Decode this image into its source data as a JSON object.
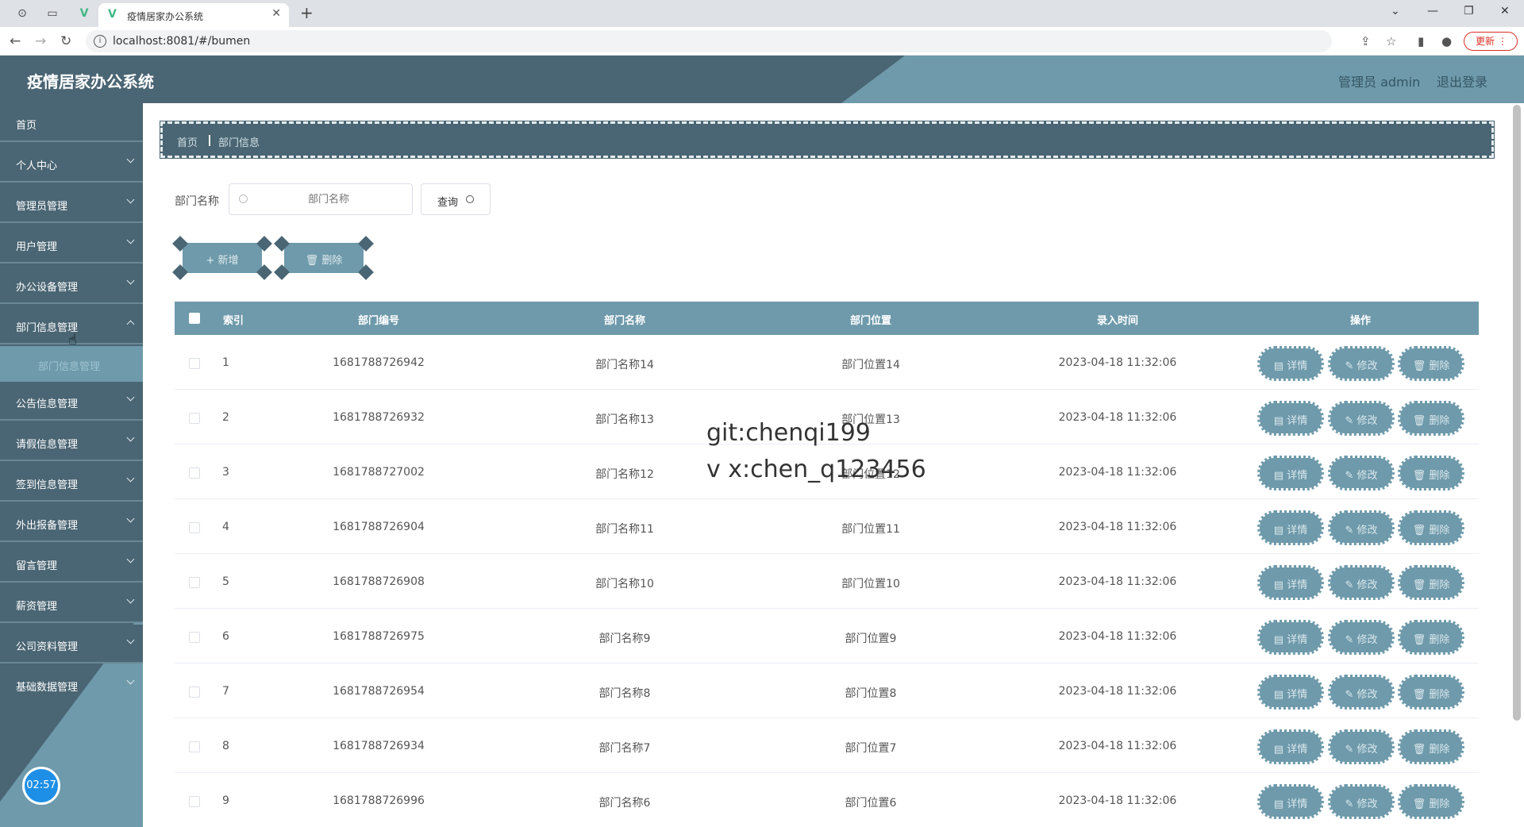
{
  "browser": {
    "tab_title": "疫情居家办公系统",
    "url": "localhost:8081/#/bumen",
    "update_label": "更新"
  },
  "header": {
    "app_title": "疫情居家办公系统",
    "user": "管理员 admin",
    "logout": "退出登录"
  },
  "sidebar": {
    "items": [
      {
        "label": "首页"
      },
      {
        "label": "个人中心"
      },
      {
        "label": "管理员管理"
      },
      {
        "label": "用户管理"
      },
      {
        "label": "办公设备管理"
      },
      {
        "label": "部门信息管理"
      },
      {
        "label": "公告信息管理"
      },
      {
        "label": "请假信息管理"
      },
      {
        "label": "签到信息管理"
      },
      {
        "label": "外出报备管理"
      },
      {
        "label": "留言管理"
      },
      {
        "label": "薪资管理"
      },
      {
        "label": "公司资料管理"
      },
      {
        "label": "基础数据管理"
      }
    ],
    "submenu": {
      "label": "部门信息管理"
    },
    "clock": "02:57"
  },
  "breadcrumb": {
    "home": "首页",
    "current": "部门信息"
  },
  "search": {
    "label": "部门名称",
    "placeholder": "部门名称",
    "button": "查询"
  },
  "actions": {
    "add": "+ 新增",
    "delete": "删除"
  },
  "table": {
    "headers": {
      "index": "索引",
      "code": "部门编号",
      "name": "部门名称",
      "location": "部门位置",
      "time": "录入时间",
      "ops": "操作"
    },
    "rows": [
      {
        "index": "1",
        "code": "1681788726942",
        "name": "部门名称14",
        "location": "部门位置14",
        "time": "2023-04-18 11:32:06"
      },
      {
        "index": "2",
        "code": "1681788726932",
        "name": "部门名称13",
        "location": "部门位置13",
        "time": "2023-04-18 11:32:06"
      },
      {
        "index": "3",
        "code": "1681788727002",
        "name": "部门名称12",
        "location": "部门位置12",
        "time": "2023-04-18 11:32:06"
      },
      {
        "index": "4",
        "code": "1681788726904",
        "name": "部门名称11",
        "location": "部门位置11",
        "time": "2023-04-18 11:32:06"
      },
      {
        "index": "5",
        "code": "1681788726908",
        "name": "部门名称10",
        "location": "部门位置10",
        "time": "2023-04-18 11:32:06"
      },
      {
        "index": "6",
        "code": "1681788726975",
        "name": "部门名称9",
        "location": "部门位置9",
        "time": "2023-04-18 11:32:06"
      },
      {
        "index": "7",
        "code": "1681788726954",
        "name": "部门名称8",
        "location": "部门位置8",
        "time": "2023-04-18 11:32:06"
      },
      {
        "index": "8",
        "code": "1681788726934",
        "name": "部门名称7",
        "location": "部门位置7",
        "time": "2023-04-18 11:32:06"
      },
      {
        "index": "9",
        "code": "1681788726996",
        "name": "部门名称6",
        "location": "部门位置6",
        "time": "2023-04-18 11:32:06"
      }
    ],
    "op_labels": {
      "detail": "详情",
      "edit": "修改",
      "delete": "删除"
    }
  },
  "watermark": {
    "line1": "git:chenqi199",
    "line2": "v x:chen_q123456"
  }
}
